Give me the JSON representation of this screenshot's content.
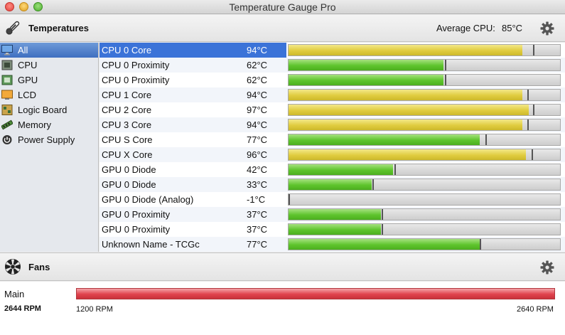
{
  "window": {
    "title": "Temperature Gauge Pro"
  },
  "temperatures": {
    "title": "Temperatures",
    "average_label": "Average CPU:",
    "average_value": "85°C"
  },
  "sidebar": {
    "items": [
      {
        "label": "All",
        "icon": "display-icon"
      },
      {
        "label": "CPU",
        "icon": "chip-icon"
      },
      {
        "label": "GPU",
        "icon": "gpu-icon"
      },
      {
        "label": "LCD",
        "icon": "lcd-icon"
      },
      {
        "label": "Logic Board",
        "icon": "board-icon"
      },
      {
        "label": "Memory",
        "icon": "memory-icon"
      },
      {
        "label": "Power Supply",
        "icon": "power-icon"
      }
    ],
    "selected": "All"
  },
  "sensors": [
    {
      "name": "CPU 0 Core",
      "temp": "94°C",
      "level": 0.86,
      "max": 0.9,
      "color": "yellow"
    },
    {
      "name": "CPU 0 Proximity",
      "temp": "62°C",
      "level": 0.57,
      "max": 0.575,
      "color": "green"
    },
    {
      "name": "CPU 0 Proximity",
      "temp": "62°C",
      "level": 0.57,
      "max": 0.575,
      "color": "green"
    },
    {
      "name": "CPU 1 Core",
      "temp": "94°C",
      "level": 0.86,
      "max": 0.88,
      "color": "yellow"
    },
    {
      "name": "CPU 2 Core",
      "temp": "97°C",
      "level": 0.885,
      "max": 0.9,
      "color": "yellow"
    },
    {
      "name": "CPU 3 Core",
      "temp": "94°C",
      "level": 0.86,
      "max": 0.88,
      "color": "yellow"
    },
    {
      "name": "CPU S Core",
      "temp": "77°C",
      "level": 0.705,
      "max": 0.725,
      "color": "green"
    },
    {
      "name": "CPU X Core",
      "temp": "96°C",
      "level": 0.875,
      "max": 0.895,
      "color": "yellow"
    },
    {
      "name": "GPU 0 Diode",
      "temp": "42°C",
      "level": 0.385,
      "max": 0.39,
      "color": "green"
    },
    {
      "name": "GPU 0 Diode",
      "temp": "33°C",
      "level": 0.305,
      "max": 0.31,
      "color": "green"
    },
    {
      "name": "GPU 0 Diode (Analog)",
      "temp": "-1°C",
      "level": 0.0,
      "max": 0.0,
      "color": "green"
    },
    {
      "name": "GPU 0 Proximity",
      "temp": "37°C",
      "level": 0.34,
      "max": 0.342,
      "color": "green"
    },
    {
      "name": "GPU 0 Proximity",
      "temp": "37°C",
      "level": 0.34,
      "max": 0.342,
      "color": "green"
    },
    {
      "name": "Unknown Name - TCGc",
      "temp": "77°C",
      "level": 0.705,
      "max": 0.705,
      "color": "green"
    }
  ],
  "colors": {
    "green": "#5ec42c",
    "yellow": "#e0cc3f",
    "fan": "#e0424d",
    "selection": "#3b73d8"
  },
  "fans": {
    "title": "Fans",
    "items": [
      {
        "name": "Main",
        "rpm": "2644 RPM",
        "min": "1200 RPM",
        "max": "2640 RPM",
        "level": 1.0
      }
    ]
  }
}
